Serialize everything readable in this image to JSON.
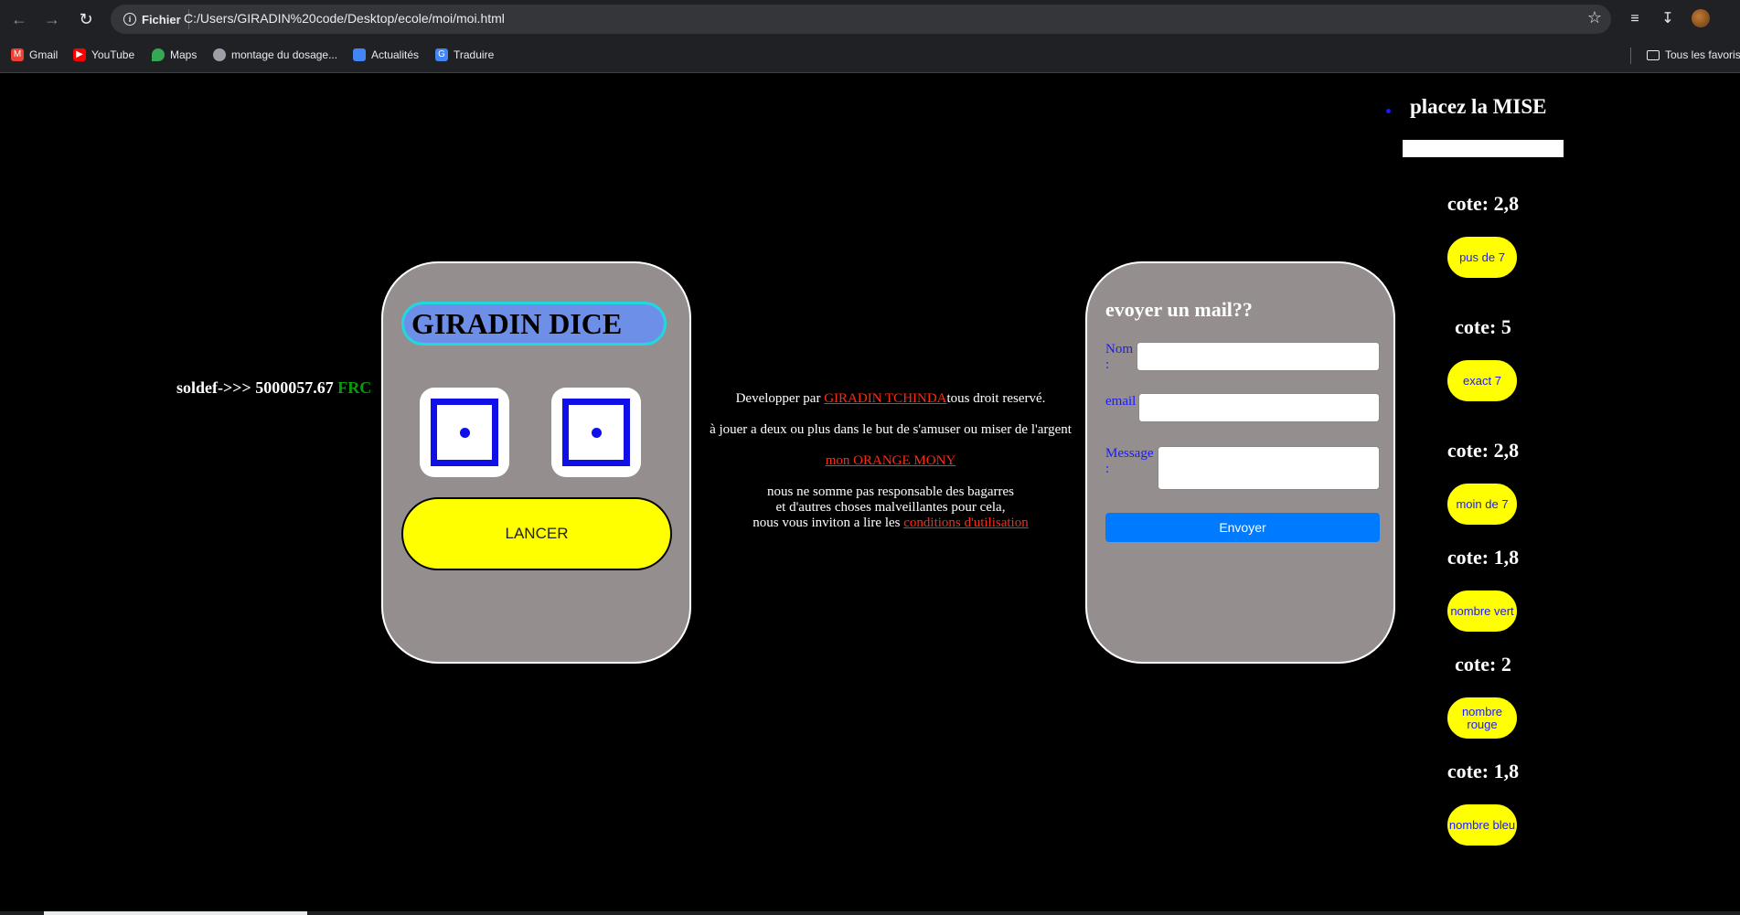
{
  "browser": {
    "back_icon": "arrow-left-icon",
    "forward_icon": "arrow-right-icon",
    "reload_icon": "reload-icon",
    "site_chip": "Fichier",
    "url": "C:/Users/GIRADIN%20code/Desktop/ecole/moi/moi.html",
    "bookmarks": [
      {
        "label": "Gmail",
        "icon": "gmail-icon",
        "color": "#ea4335"
      },
      {
        "label": "YouTube",
        "icon": "youtube-icon",
        "color": "#ff0000"
      },
      {
        "label": "Maps",
        "icon": "maps-icon",
        "color": "#34a853"
      },
      {
        "label": "montage du dosage...",
        "icon": "globe-icon",
        "color": "#9aa0a6"
      },
      {
        "label": "Actualités",
        "icon": "news-icon",
        "color": "#4285f4"
      },
      {
        "label": "Traduire",
        "icon": "translate-icon",
        "color": "#4285f4"
      }
    ],
    "all_bookmarks": "Tous les favoris"
  },
  "balance": {
    "prefix": "soldef->>> 5000057.67",
    "currency": "FRC"
  },
  "dice": {
    "title": "GIRADIN DICE",
    "roll_label": "LANCER",
    "die1": 1,
    "die2": 1
  },
  "center": {
    "dev_prefix": "Developper par ",
    "dev_link": "GIRADIN TCHINDA",
    "dev_suffix": "tous droit reservé.",
    "tagline": "à jouer a deux ou plus dans le but de s'amuser ou miser de l'argent",
    "orange_link": "mon ORANGE MONY",
    "disclaimer1": "nous ne somme pas responsable des bagarres",
    "disclaimer2": "et d'autres choses malveillantes pour cela,",
    "disclaimer3": "nous vous inviton a lire les ",
    "conditions_link": "conditions d'utilisation"
  },
  "mail": {
    "title": "evoyer un mail??",
    "name_label": "Nom :",
    "email_label": "email",
    "message_label": "Message :",
    "send_label": "Envoyer"
  },
  "bets": {
    "title": "placez la MISE",
    "options": [
      {
        "cote": "cote: 2,8",
        "label": "pus de 7"
      },
      {
        "cote": "cote: 5",
        "label": "exact 7"
      },
      {
        "cote": "cote: 2,8",
        "label": "moin de 7"
      },
      {
        "cote": "cote: 1,8",
        "label": "nombre vert"
      },
      {
        "cote": "cote: 2",
        "label": "nombre rouge"
      },
      {
        "cote": "cote: 1,8",
        "label": "nombre bleu"
      }
    ]
  }
}
